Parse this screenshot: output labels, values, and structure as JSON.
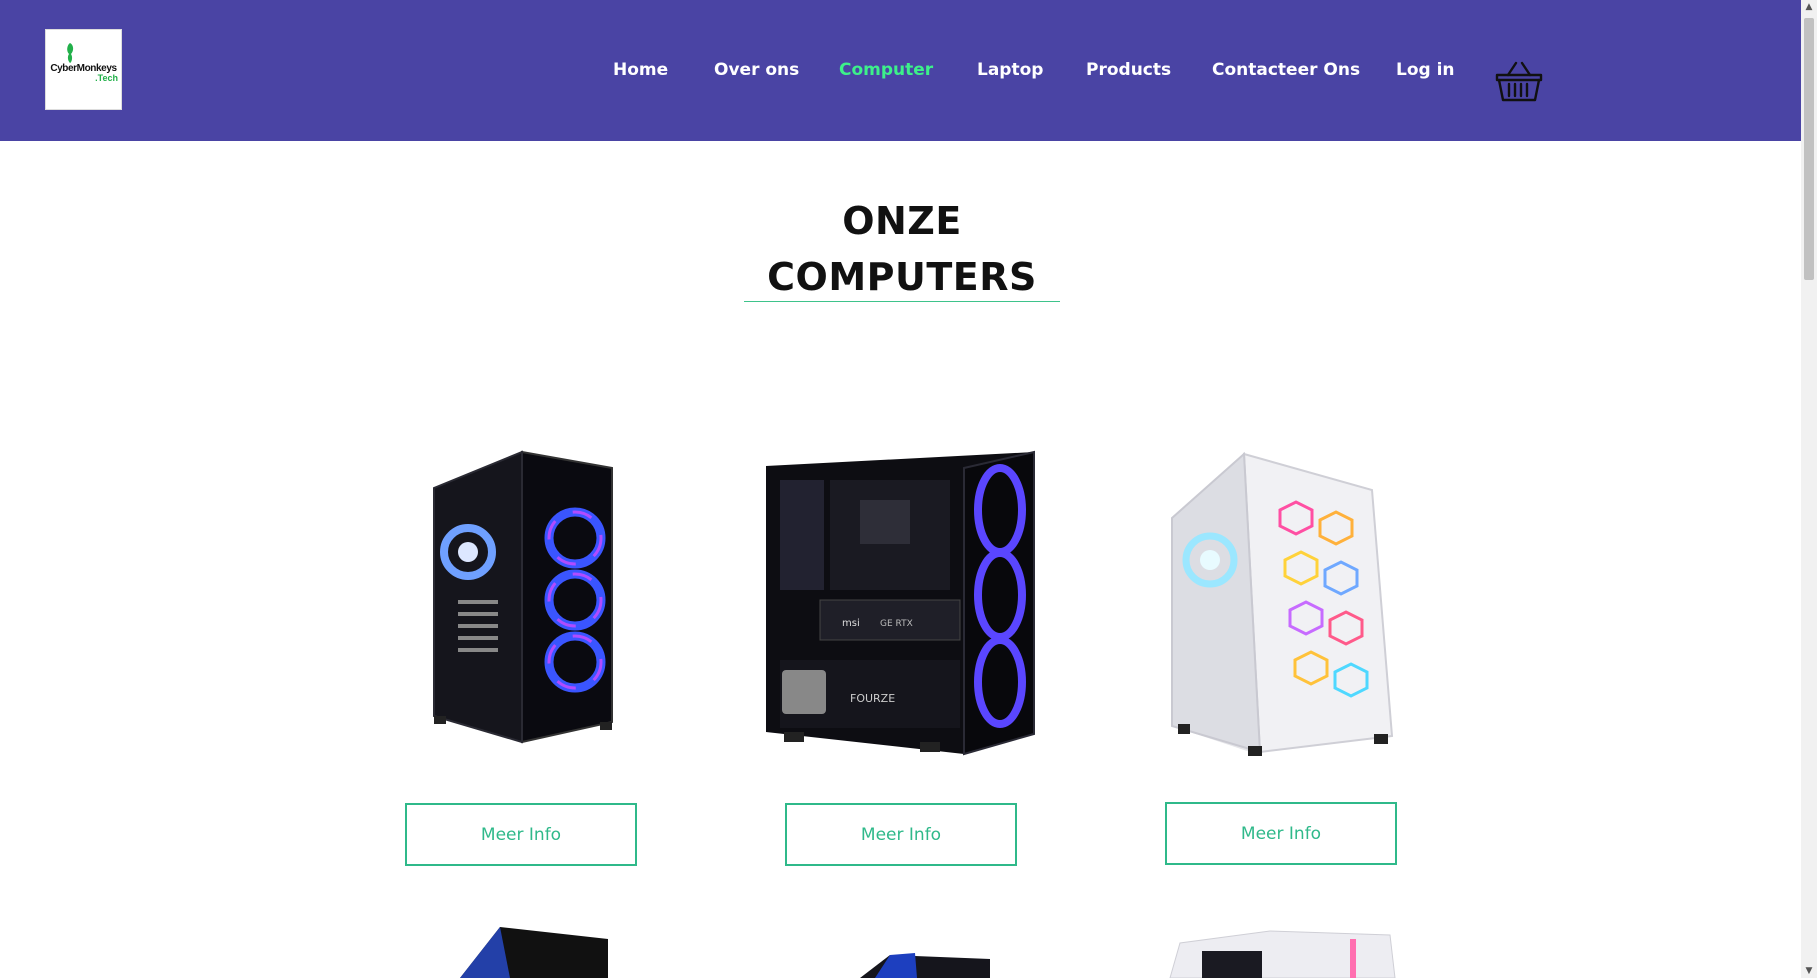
{
  "brand": {
    "line1": "CyberMonkeys",
    "line2": ".Tech"
  },
  "nav": {
    "items": [
      {
        "label": "Home",
        "active": false
      },
      {
        "label": "Over ons",
        "active": false
      },
      {
        "label": "Computer",
        "active": true
      },
      {
        "label": "Laptop",
        "active": false
      },
      {
        "label": "Products",
        "active": false
      },
      {
        "label": "Contacteer Ons",
        "active": false
      },
      {
        "label": "Log in",
        "active": false
      }
    ],
    "cart_icon": "basket-icon"
  },
  "section": {
    "title_line1": "ONZE",
    "title_line2": "COMPUTERS"
  },
  "products": [
    {
      "button_label": "Meer Info",
      "image": "black-pc-case-blue-fans"
    },
    {
      "button_label": "Meer Info",
      "image": "black-pc-case-blue-rings"
    },
    {
      "button_label": "Meer Info",
      "image": "white-pc-case-rgb-mesh"
    }
  ],
  "colors": {
    "navbar": "#4a44a4",
    "active_link": "#3df08a",
    "accent": "#2fb98a"
  }
}
